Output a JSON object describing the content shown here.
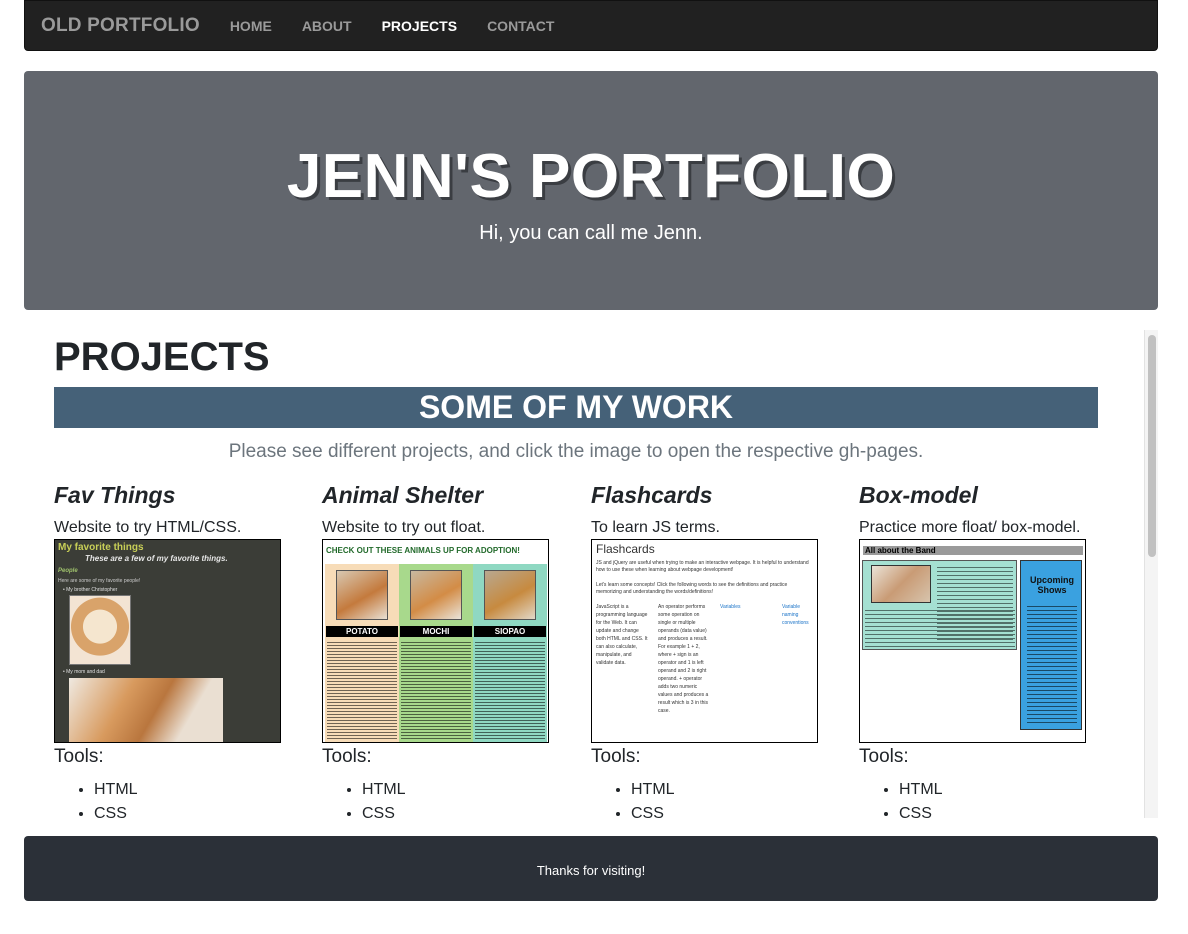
{
  "navbar": {
    "brand": "OLD PORTFOLIO",
    "items": [
      {
        "label": "HOME",
        "active": false
      },
      {
        "label": "ABOUT",
        "active": false
      },
      {
        "label": "PROJECTS",
        "active": true
      },
      {
        "label": "CONTACT",
        "active": false
      }
    ]
  },
  "hero": {
    "title": "JENN'S PORTFOLIO",
    "subtitle": "Hi, you can call me Jenn."
  },
  "main": {
    "section_title": "PROJECTS",
    "banner": "SOME OF MY WORK",
    "lead": "Please see different projects, and click the image to open the respective gh-pages.",
    "projects": [
      {
        "title": "Fav Things",
        "desc": "Website to try HTML/CSS.",
        "tools_label": "Tools:",
        "tools": [
          "HTML",
          "CSS"
        ],
        "thumb": {
          "heading": "My favorite things",
          "subheading": "These are a few of my favorite things.",
          "people": "People",
          "intro": "Here are some of my favorite people!",
          "bullet1": "My brother Christopher",
          "bullet2": "My mom and dad"
        }
      },
      {
        "title": "Animal Shelter",
        "desc": "Website to try out float.",
        "tools_label": "Tools:",
        "tools": [
          "HTML",
          "CSS"
        ],
        "thumb": {
          "heading": "CHECK OUT THESE ANIMALS UP FOR ADOPTION!",
          "animals": [
            "POTATO",
            "MOCHI",
            "SIOPAO"
          ]
        }
      },
      {
        "title": "Flashcards",
        "desc": "To learn JS terms.",
        "tools_label": "Tools:",
        "tools": [
          "HTML",
          "CSS"
        ],
        "thumb": {
          "heading": "Flashcards",
          "para1": "JS and jQuery are useful when trying to make an interactive webpage. It is helpful to understand how to use these when learning about webpage development!",
          "para2": "Let's learn some concepts! Click the following words to see the definitions and practice memorizing and understanding the words/definitions!",
          "col1": "JavaScript is a programming language for the Web. It can update and change both HTML and CSS. It can also calculate, manipulate, and validate data.",
          "col2": "An operator performs some operation on single or multiple operands (data value) and produces a result. For example 1 + 2, where + sign is an operator and 1 is left operand and 2 is right operand. + operator adds two numeric values and produces a result which is 3 in this case.",
          "col3": "Variables",
          "col4": "Variable naming conventions"
        }
      },
      {
        "title": "Box-model",
        "desc": "Practice more float/ box-model.",
        "tools_label": "Tools:",
        "tools": [
          "HTML",
          "CSS"
        ],
        "thumb": {
          "heading": "All about the Band",
          "side_heading": "Upcoming Shows"
        }
      }
    ]
  },
  "footer": {
    "text": "Thanks for visiting!"
  },
  "colors": {
    "navbar_bg": "#212121",
    "hero_bg": "#62666d",
    "banner_bg": "#456178",
    "footer_bg": "#2b3038"
  }
}
